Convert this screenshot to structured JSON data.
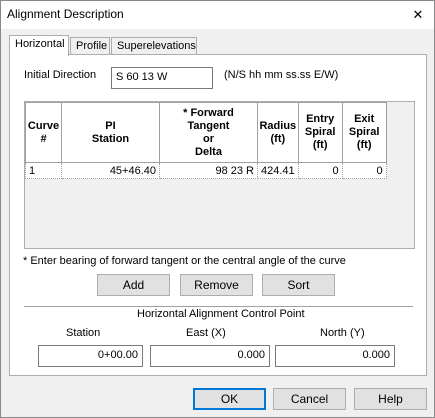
{
  "window": {
    "title": "Alignment Description",
    "close": "✕"
  },
  "tabs": [
    {
      "label": "Horizontal",
      "active": true
    },
    {
      "label": "Profile",
      "active": false
    },
    {
      "label": "Superelevations",
      "active": false
    }
  ],
  "initial_direction": {
    "label": "Initial Direction",
    "value": "S 60 13 W",
    "format_hint": "(N/S hh mm ss.ss E/W)"
  },
  "curve_table": {
    "headers": {
      "curve": [
        "Curve",
        "#"
      ],
      "pi_station": [
        "PI",
        "Station"
      ],
      "forward_tangent": [
        "* Forward",
        "Tangent",
        "or",
        "Delta"
      ],
      "radius": [
        "Radius",
        "(ft)"
      ],
      "entry_spiral": [
        "Entry",
        "Spiral",
        "(ft)"
      ],
      "exit_spiral": [
        "Exit",
        "Spiral",
        "(ft)"
      ]
    },
    "rows": [
      {
        "curve": "1",
        "pi_station": "45+46.40",
        "forward_tangent": "98 23 R",
        "radius": "424.41",
        "entry_spiral": "0",
        "exit_spiral": "0"
      }
    ]
  },
  "note": "* Enter bearing of forward tangent or the central angle of the curve",
  "row_buttons": {
    "add": "Add",
    "remove": "Remove",
    "sort": "Sort"
  },
  "control_point": {
    "heading": "Horizontal Alignment Control Point",
    "station_label": "Station",
    "station_value": "0+00.00",
    "east_label": "East (X)",
    "east_value": "0.000",
    "north_label": "North (Y)",
    "north_value": "0.000"
  },
  "dialog_buttons": {
    "ok": "OK",
    "cancel": "Cancel",
    "help": "Help"
  }
}
